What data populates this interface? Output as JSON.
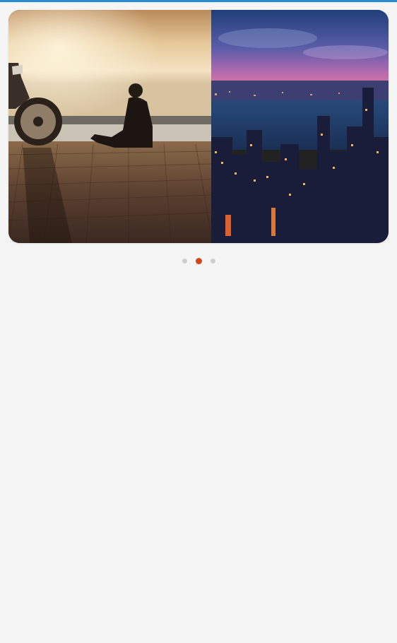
{
  "status_bar": {
    "accent_color": "#2a8bd6"
  },
  "carousel": {
    "slides": [
      {
        "name": "motorbike-sunset-slide",
        "description_icon": "photo-icon"
      },
      {
        "name": "city-night-skyline-slide",
        "description_icon": "photo-icon"
      }
    ],
    "indicator": {
      "count": 3,
      "active_index": 1,
      "active_color": "#d0461e",
      "inactive_color": "#cfcfcf"
    }
  }
}
